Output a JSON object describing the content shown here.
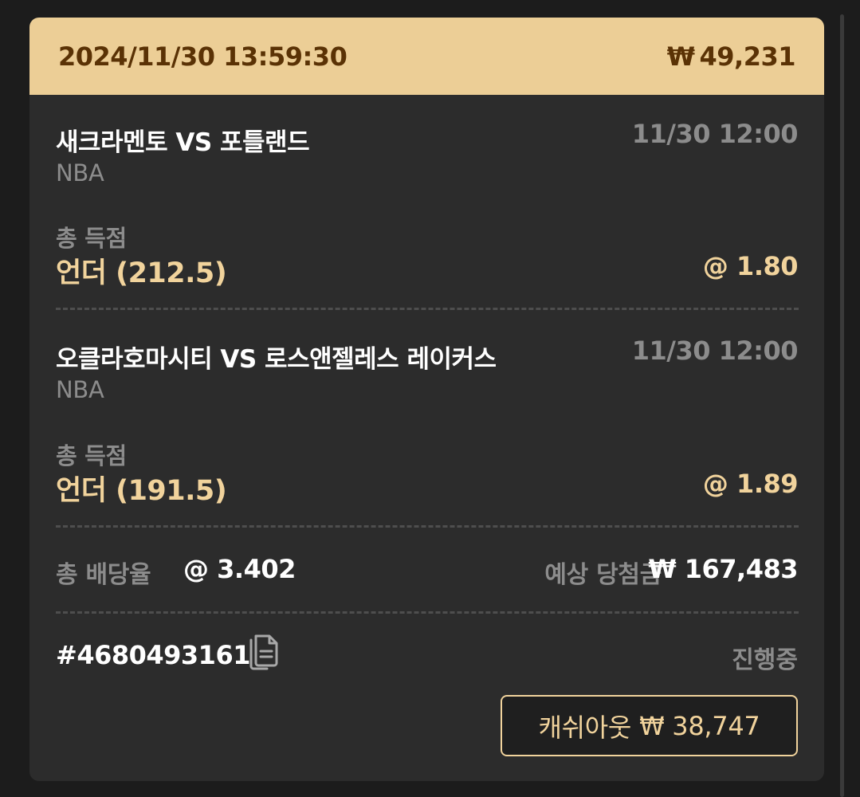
{
  "header": {
    "datetime": "2024/11/30 13:59:30",
    "currency_symbol": "₩",
    "stake": "49,231"
  },
  "selections": [
    {
      "match": "새크라멘토 VS 포틀랜드",
      "time": "11/30 12:00",
      "league": "NBA",
      "market": "총 득점",
      "pick": "언더 (212.5)",
      "odds": "@ 1.80"
    },
    {
      "match": "오클라호마시티 VS 로스앤젤레스 레이커스",
      "time": "11/30 12:00",
      "league": "NBA",
      "market": "총 득점",
      "pick": "언더 (191.5)",
      "odds": "@ 1.89"
    }
  ],
  "summary": {
    "total_odds_label": "총 배당율",
    "total_odds_value": "@ 3.402",
    "expected_win_label": "예상 당첨금",
    "currency_symbol": "₩",
    "expected_win_value": "167,483"
  },
  "footer": {
    "bet_id": "#4680493161",
    "status": "진행중",
    "copy_icon": "copy-document-icon",
    "cashout_label": "캐쉬아웃",
    "cashout_currency": "₩",
    "cashout_amount": "38,747"
  },
  "colors": {
    "header_bg": "#ecce96",
    "header_text": "#5a3205",
    "card_bg": "#2c2c2c",
    "accent_gold": "#f1d39c",
    "muted_text": "#8c8c8c"
  }
}
